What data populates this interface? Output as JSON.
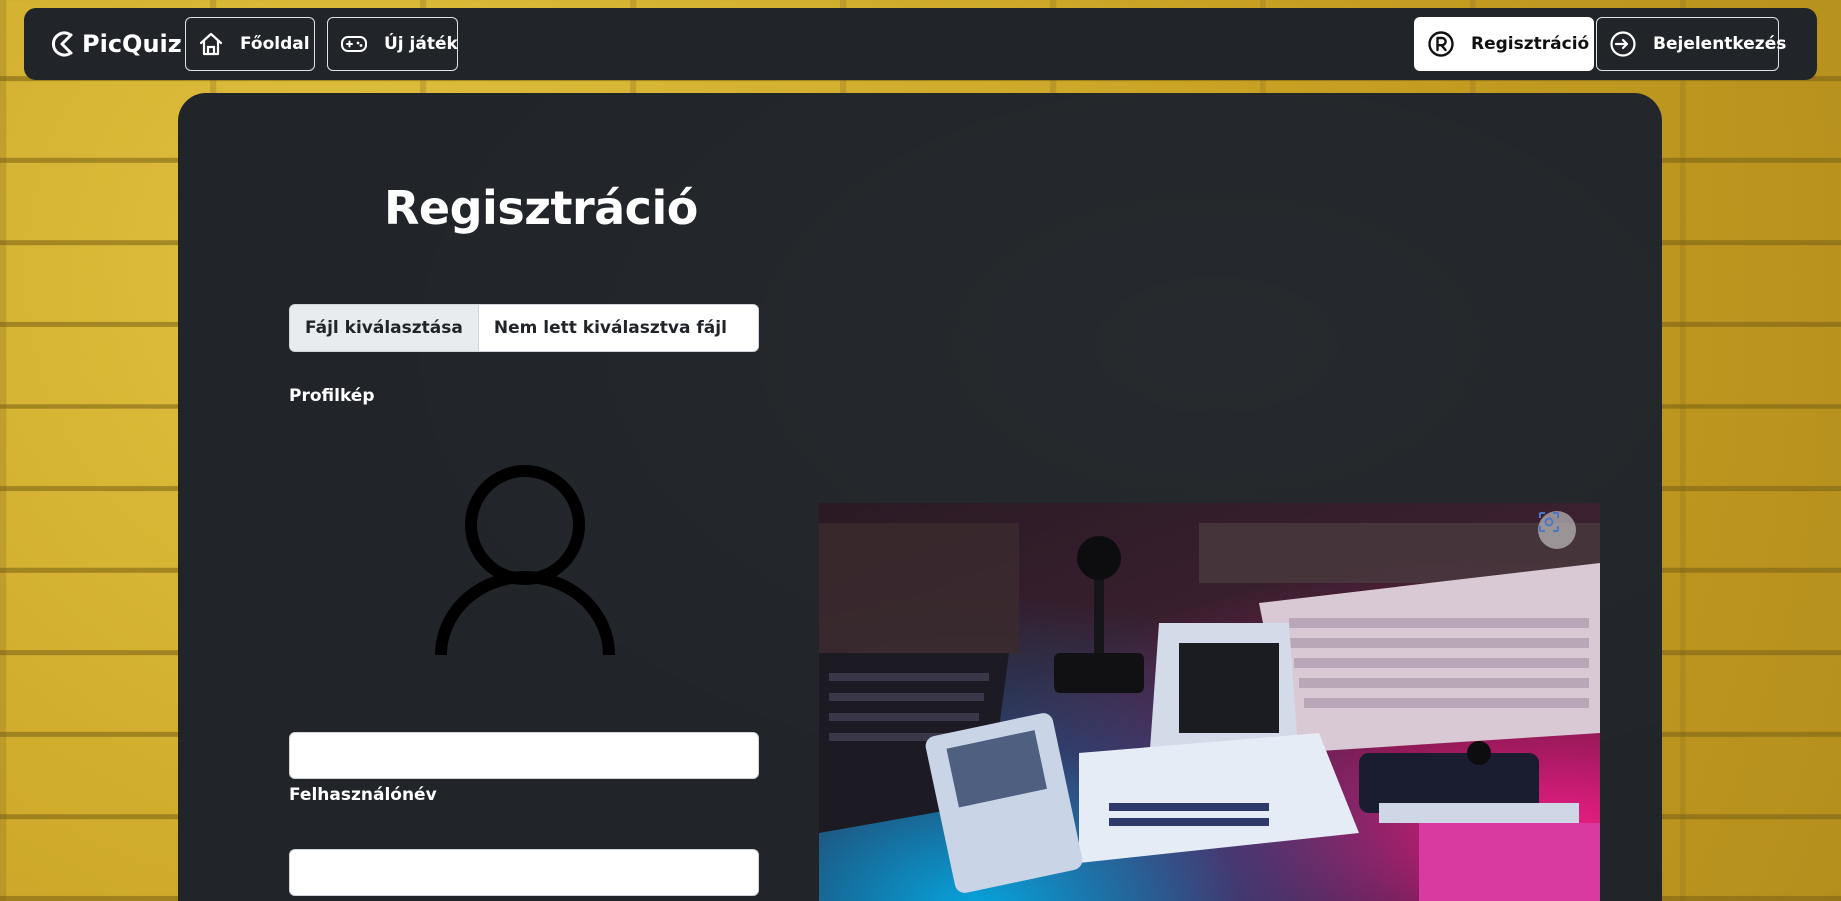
{
  "navbar": {
    "brand": "PicQuiz",
    "home_label": "Főoldal",
    "new_game_label": "Új játék",
    "register_label": "Regisztráció",
    "login_label": "Bejelentkezés"
  },
  "form": {
    "title": "Regisztráció",
    "file_button_label": "Fájl kiválasztása",
    "file_status": "Nem lett kiválasztva fájl",
    "profile_label": "Profilkép",
    "username_label": "Felhasználónév",
    "username_value": "",
    "second_value": ""
  },
  "icons": {
    "brand": "picquiz-logo-icon",
    "home": "house-icon",
    "new_game": "gamepad-icon",
    "register": "registered-icon",
    "login": "sign-in-icon",
    "avatar": "person-icon",
    "lens": "visual-search-icon"
  },
  "colors": {
    "navbar_bg": "#212529",
    "card_bg": "#212529",
    "text": "#ffffff",
    "active_button_bg": "#ffffff"
  }
}
